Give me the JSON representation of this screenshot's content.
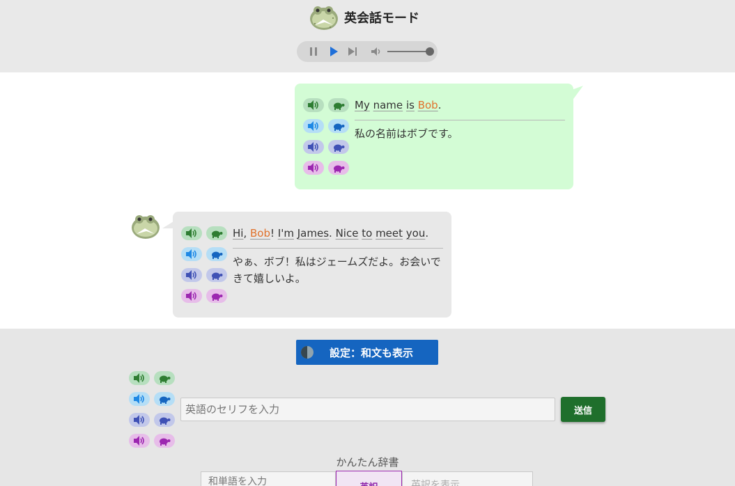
{
  "header": {
    "title": "英会話モード",
    "player": {
      "pause_icon": "pause-icon",
      "play_icon": "play-icon",
      "skip_icon": "skip-next-icon",
      "volume_icon": "volume-icon",
      "volume_level": 1.0
    }
  },
  "colors": {
    "green": "#2e7d32",
    "green_bg": "#b7dfbf",
    "light_blue": "#1e88e5",
    "light_blue_bg": "#b5def6",
    "indigo": "#3f51b5",
    "indigo_bg": "#c2c8ea",
    "purple": "#9c27b0",
    "purple_bg": "#e7bde9",
    "name_highlight": "#e0722c",
    "send_button": "#1f6f2c",
    "settings_button": "#1565c0"
  },
  "messages": [
    {
      "speaker": "me",
      "english": [
        {
          "t": "My",
          "k": "w"
        },
        {
          "t": " ",
          "k": "s"
        },
        {
          "t": "name",
          "k": "w"
        },
        {
          "t": " ",
          "k": "s"
        },
        {
          "t": "is",
          "k": "w"
        },
        {
          "t": " ",
          "k": "s"
        },
        {
          "t": "Bob",
          "k": "n"
        },
        {
          "t": ".",
          "k": "s"
        }
      ],
      "japanese": "私の名前はボブです。"
    },
    {
      "speaker": "other",
      "english": [
        {
          "t": "Hi",
          "k": "w"
        },
        {
          "t": ", ",
          "k": "s"
        },
        {
          "t": "Bob",
          "k": "n"
        },
        {
          "t": "! ",
          "k": "s"
        },
        {
          "t": "I'm",
          "k": "w"
        },
        {
          "t": " ",
          "k": "s"
        },
        {
          "t": "James",
          "k": "w"
        },
        {
          "t": ". ",
          "k": "s"
        },
        {
          "t": "Nice",
          "k": "w"
        },
        {
          "t": " ",
          "k": "s"
        },
        {
          "t": "to",
          "k": "w"
        },
        {
          "t": " ",
          "k": "s"
        },
        {
          "t": "meet",
          "k": "w"
        },
        {
          "t": " ",
          "k": "s"
        },
        {
          "t": "you",
          "k": "w"
        },
        {
          "t": ".",
          "k": "s"
        }
      ],
      "japanese": "やぁ、ボブ！私はジェームズだよ。お会いできて嬉しいよ。"
    }
  ],
  "voice_buttons": {
    "speaker_icon": "speaker-icon",
    "turtle_icon": "turtle-icon"
  },
  "bottom": {
    "settings_label": "設定：和文も表示",
    "settings_icon": "contrast-icon",
    "input_placeholder": "英語のセリフを入力",
    "send_label": "送信",
    "dictionary_label": "かんたん辞書",
    "dict_input_placeholder": "和単語を入力",
    "dict_button_label": "英訳",
    "dict_result_placeholder": "英訳を表示"
  }
}
